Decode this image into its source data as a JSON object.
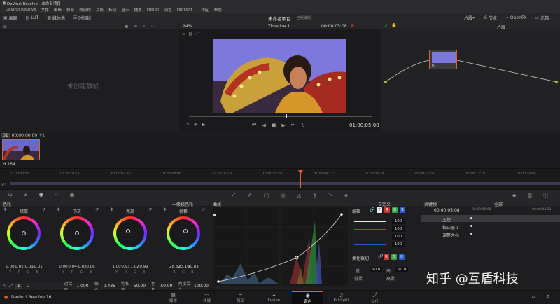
{
  "window": {
    "title": "DaVinci Resolve - 未命名项目"
  },
  "menubar": [
    "DaVinci Resolve",
    "文件",
    "编辑",
    "修剪",
    "时间线",
    "片段",
    "标记",
    "显示",
    "播放",
    "Fusion",
    "调色",
    "Fairlight",
    "工作区",
    "帮助"
  ],
  "toolbar": {
    "gallery": "画廊",
    "lut": "LUT",
    "media_pool": "媒体池",
    "timeline": "时间线",
    "project": "未命名项目",
    "edited": "已经编辑",
    "clip_menu": "片段",
    "nodes": "节点",
    "openfx": "OpenFX",
    "lightbox": "光箱"
  },
  "viewer": {
    "zoom": "24%",
    "timeline_name": "Timeline 1",
    "timecode_top": "00:00:05:08",
    "timecode": "01:00:05:08",
    "no_still": "未创建静帧"
  },
  "node_editor": {
    "menu": "片段",
    "node_num": "01"
  },
  "clips": {
    "num": "01",
    "timecode": "00:00:00:00",
    "track": "V1",
    "codec": "H.264"
  },
  "ruler": [
    "01:00:00:00",
    "01:00:01:12",
    "01:00:02:24",
    "01:00:04:06",
    "01:00:05:18",
    "01:00:07:00",
    "01:00:08:12",
    "01:00:09:24",
    "01:00:11:06",
    "01:00:12:18",
    "01:00:14:00"
  ],
  "ruler_track": "V1",
  "color_wheels": {
    "title": "色轮",
    "mode": "一级校色轮",
    "wheels": [
      {
        "name": "暗部",
        "values": [
          "0.00",
          "0.02",
          "-0.01",
          "-0.01"
        ],
        "chan": [
          "Y",
          "R",
          "G",
          "B"
        ],
        "dot_dx": 0,
        "dot_dy": 0
      },
      {
        "name": "中灰",
        "values": [
          "0.00",
          "0.04",
          "-0.02",
          "0.06"
        ],
        "chan": [
          "Y",
          "R",
          "G",
          "B"
        ],
        "dot_dx": 0,
        "dot_dy": 0
      },
      {
        "name": "亮部",
        "values": [
          "1.00",
          "0.93",
          "1.02",
          "0.99"
        ],
        "chan": [
          "Y",
          "R",
          "G",
          "B"
        ],
        "dot_dx": -1,
        "dot_dy": -1
      },
      {
        "name": "偏移",
        "values": [
          "28.32",
          "23.16",
          "30.83"
        ],
        "chan": [
          "R",
          "G",
          "B"
        ],
        "dot_dx": 1,
        "dot_dy": -1
      }
    ],
    "footer": {
      "page1": "1",
      "page2": "2",
      "contrast_label": "对比度",
      "contrast": "1.000",
      "pivot_label": "轴心",
      "pivot": "0.435",
      "sat_label": "饱和度",
      "sat": "50.00",
      "hue_label": "色相",
      "hue": "50.00",
      "lum_label": "亮度混合",
      "lum": "100.00"
    }
  },
  "curves": {
    "title": "曲线",
    "edit": "编辑",
    "channels": [
      "Y",
      "R",
      "G",
      "B"
    ],
    "values": [
      "100",
      "100",
      "100",
      "100"
    ],
    "soft_clip": "柔化裁切",
    "low": "低",
    "high": "高",
    "low_soft": "低柔",
    "high_soft": "高柔",
    "low_val": "50.0",
    "high_val": "50.0",
    "auto": "自定义"
  },
  "keyframes": {
    "title": "关键帧",
    "all": "全部",
    "tc": "00:00:05:08",
    "tc1": "00:00:00:00",
    "tc2": "00:00:04:21",
    "rows": [
      "主控",
      "校正器 1",
      "调整大小"
    ]
  },
  "pages": [
    "媒体",
    "快编",
    "剪辑",
    "Fusion",
    "调色",
    "Fairlight",
    "交付"
  ],
  "active_page": "调色",
  "app_name": "DaVinci Resolve 16",
  "watermark": "知乎 @互盾科技",
  "colors": {
    "accent": "#e6622a",
    "curve": "#d0d0d0"
  }
}
